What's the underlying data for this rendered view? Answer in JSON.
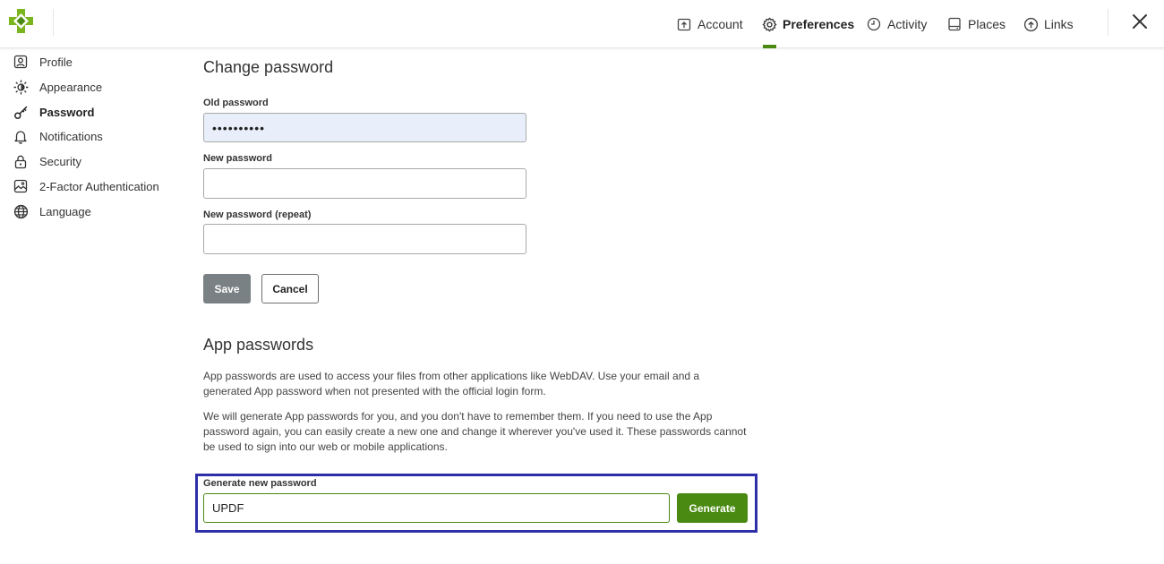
{
  "header": {
    "nav": [
      {
        "label": "Account",
        "icon": "account-upload-icon"
      },
      {
        "label": "Preferences",
        "icon": "gear-icon",
        "active": true
      },
      {
        "label": "Activity",
        "icon": "clock-icon"
      },
      {
        "label": "Places",
        "icon": "drive-icon"
      },
      {
        "label": "Links",
        "icon": "cloud-upload-icon"
      }
    ],
    "close_icon": "close-icon"
  },
  "sidebar": {
    "items": [
      {
        "label": "Profile",
        "icon": "profile-icon"
      },
      {
        "label": "Appearance",
        "icon": "sun-icon"
      },
      {
        "label": "Password",
        "icon": "key-icon",
        "active": true
      },
      {
        "label": "Notifications",
        "icon": "bell-icon"
      },
      {
        "label": "Security",
        "icon": "lock-icon"
      },
      {
        "label": "2-Factor Authentication",
        "icon": "image-icon"
      },
      {
        "label": "Language",
        "icon": "globe-icon"
      }
    ]
  },
  "change_password": {
    "title": "Change password",
    "old_label": "Old password",
    "old_value": "••••••••••",
    "new_label": "New password",
    "new_value": "",
    "repeat_label": "New password (repeat)",
    "repeat_value": "",
    "save_label": "Save",
    "cancel_label": "Cancel"
  },
  "app_passwords": {
    "title": "App passwords",
    "paragraph1": "App passwords are used to access your files from other applications like WebDAV. Use your email and a generated App password when not presented with the official login form.",
    "paragraph2": "We will generate App passwords for you, and you don't have to remember them. If you need to use the App password again, you can easily create a new one and change it wherever you've used it. These passwords cannot be used to sign into our web or mobile applications.",
    "generate_label": "Generate new password",
    "generate_value": "UPDF",
    "generate_button": "Generate"
  },
  "colors": {
    "accent": "#4a8a12",
    "highlight_border": "#2e2fa8",
    "save_button": "#7a8185"
  }
}
